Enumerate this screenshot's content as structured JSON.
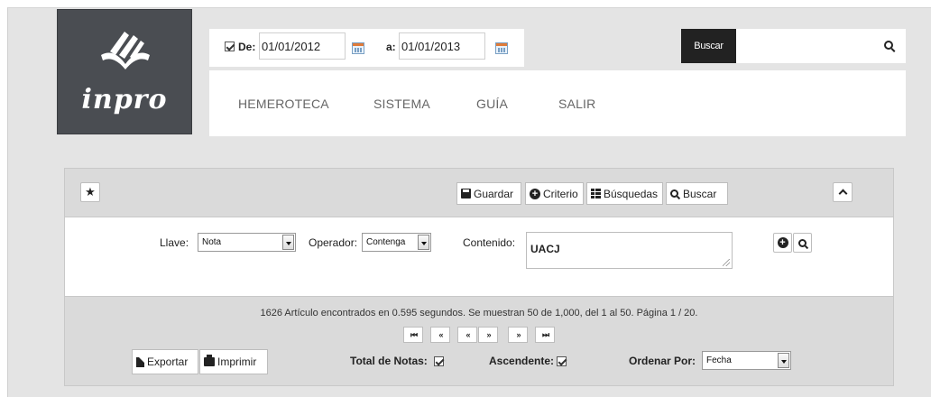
{
  "brand": {
    "name": "inpro"
  },
  "date_filter": {
    "from_label": "De:",
    "from_value": "01/01/2012",
    "to_label": "a:",
    "to_value": "01/01/2013"
  },
  "search": {
    "button_label": "Buscar",
    "placeholder": ""
  },
  "nav": {
    "items": [
      "HEMEROTECA",
      "SISTEMA",
      "GUÍA",
      "SALIR"
    ]
  },
  "toolbar": {
    "guardar": "Guardar",
    "criterio": "Criterio",
    "busquedas": "Búsquedas",
    "buscar": "Buscar"
  },
  "criteria": {
    "llave_label": "Llave:",
    "llave_value": "Nota",
    "operador_label": "Operador:",
    "operador_value": "Contenga",
    "contenido_label": "Contenido:",
    "contenido_value": "UACJ"
  },
  "results": {
    "summary": "1626 Artículo encontrados en 0.595 segundos. Se muestran 50 de 1,000, del 1 al 50. Página 1 / 20."
  },
  "pager": {
    "buttons": [
      "⏮",
      "«",
      "«",
      "»",
      "»",
      "⏭"
    ]
  },
  "footer": {
    "exportar": "Exportar",
    "imprimir": "Imprimir",
    "total_notas_label": "Total de Notas:",
    "ascendente_label": "Ascendente:",
    "ordenar_label": "Ordenar Por:",
    "ordenar_value": "Fecha"
  },
  "colors": {
    "logo_bg": "#4a4d52",
    "search_button_bg": "#222222",
    "panel_bar_bg": "#dadada",
    "page_bg": "#e4e4e4"
  },
  "icons": [
    "book-logo-icon",
    "calendar-icon",
    "search-icon",
    "star-icon",
    "save-icon",
    "plus-circle-icon",
    "grid-icon",
    "chevron-up-icon",
    "file-icon",
    "print-icon"
  ]
}
